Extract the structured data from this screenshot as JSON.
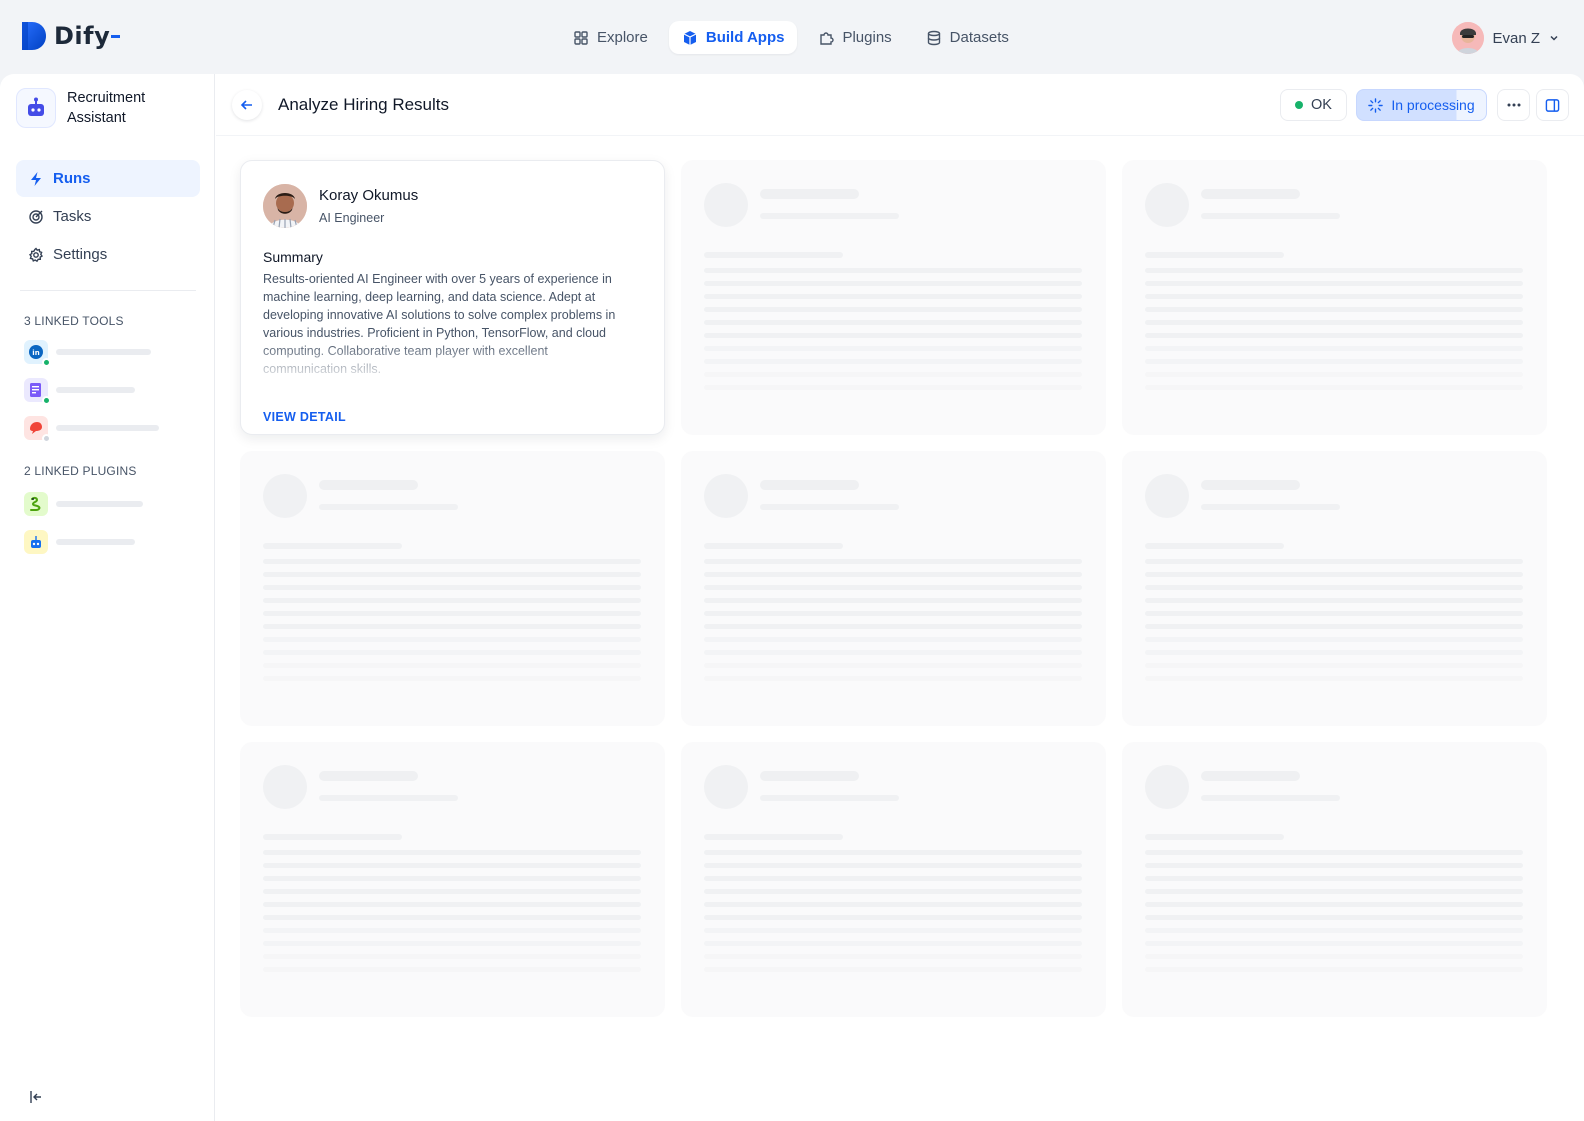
{
  "brand": {
    "name": "Dify"
  },
  "nav": [
    {
      "label": "Explore",
      "icon": "grid-icon"
    },
    {
      "label": "Build Apps",
      "icon": "cube-icon",
      "active": true
    },
    {
      "label": "Plugins",
      "icon": "puzzle-icon"
    },
    {
      "label": "Datasets",
      "icon": "database-icon"
    }
  ],
  "user": {
    "name": "Evan Z"
  },
  "sidebar": {
    "app_name": "Recruitment Assistant",
    "menu": [
      {
        "label": "Runs",
        "icon": "bolt-icon",
        "active": true
      },
      {
        "label": "Tasks",
        "icon": "target-icon"
      },
      {
        "label": "Settings",
        "icon": "gear-icon"
      }
    ],
    "tools_label": "3 LINKED TOOLS",
    "tools": [
      {
        "icon": "linkedin-icon",
        "color": "#0a66c2",
        "status": "#17b26a"
      },
      {
        "icon": "resume-icon",
        "color": "#7a5af8",
        "status": "#17b26a"
      },
      {
        "icon": "chat-icon",
        "color": "#f04438",
        "status": "#d0d5dd"
      }
    ],
    "plugins_label": "2 LINKED PLUGINS",
    "plugins": [
      {
        "icon": "snake-icon"
      },
      {
        "icon": "robot-icon"
      }
    ]
  },
  "header": {
    "title": "Analyze Hiring Results",
    "ok_label": "OK",
    "status_label": "In processing",
    "status_progress": 0.77
  },
  "result": {
    "name": "Koray Okumus",
    "role": "AI Engineer",
    "summary_title": "Summary",
    "summary": "Results-oriented AI Engineer with over 5 years of experience in machine learning, deep learning, and data science. Adept at developing innovative AI solutions to solve complex problems in various industries. Proficient in Python, TensorFlow, and cloud computing. Collaborative team player with excellent communication skills.",
    "action": "VIEW DETAIL"
  },
  "colors": {
    "accent": "#155eef",
    "success": "#17b26a"
  }
}
